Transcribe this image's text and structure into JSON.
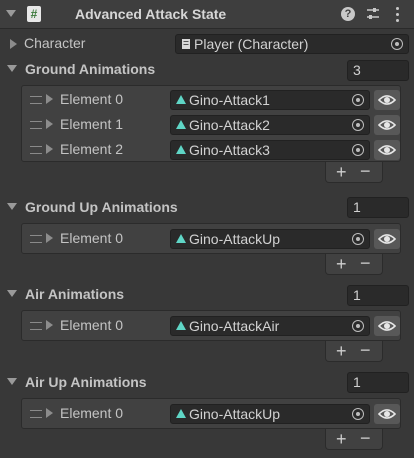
{
  "header": {
    "title": "Advanced Attack State",
    "script_icon": "script-icon",
    "help_icon": "help-icon",
    "preset_icon": "preset-icon",
    "menu_icon": "kebab-menu-icon"
  },
  "character": {
    "label": "Character",
    "value": "Player (Character)"
  },
  "lists": [
    {
      "label": "Ground Animations",
      "size": "3",
      "elements": [
        {
          "label": "Element 0",
          "value": "Gino-Attack1"
        },
        {
          "label": "Element 1",
          "value": "Gino-Attack2"
        },
        {
          "label": "Element 2",
          "value": "Gino-Attack3"
        }
      ]
    },
    {
      "label": "Ground Up Animations",
      "size": "1",
      "elements": [
        {
          "label": "Element 0",
          "value": "Gino-AttackUp"
        }
      ]
    },
    {
      "label": "Air Animations",
      "size": "1",
      "elements": [
        {
          "label": "Element 0",
          "value": "Gino-AttackAir"
        }
      ]
    },
    {
      "label": "Air Up Animations",
      "size": "1",
      "elements": [
        {
          "label": "Element 0",
          "value": "Gino-AttackUp"
        }
      ]
    }
  ],
  "footer": {
    "add_label": "+",
    "remove_label": "−"
  },
  "colors": {
    "background": "#383838",
    "field": "#2a2a2a",
    "anim_icon": "#5fd6c6"
  }
}
